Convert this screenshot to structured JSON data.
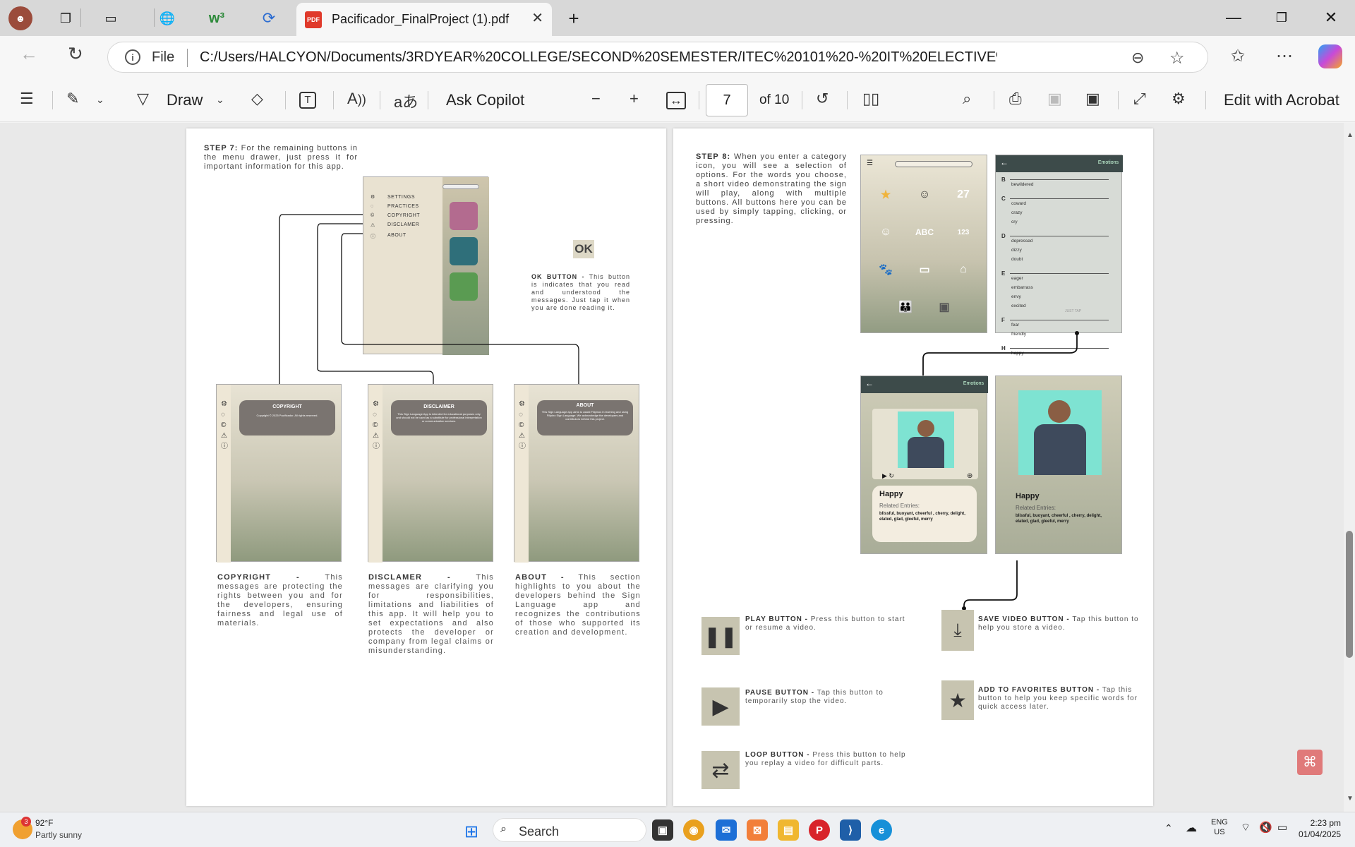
{
  "browser": {
    "tab_title": "Pacificador_FinalProject (1).pdf",
    "tab_icon": "pdf-file-icon",
    "address_prefix": "File",
    "url": "C:/Users/HALCYON/Documents/3RDYEAR%20COLLEGE/SECOND%20SEMESTER/ITEC%20101%20-%20IT%20ELECTIVE%201%20(HUMAN..."
  },
  "pdf_toolbar": {
    "draw_label": "Draw",
    "ask_copilot_label": "Ask Copilot",
    "page_current": "7",
    "page_total_label": "of 10",
    "edit_acrobat_label": "Edit with Acrobat",
    "pdf_badge": "PDF"
  },
  "left_page": {
    "step7_label": "STEP 7:",
    "step7_text": "For the remaining buttons in the menu drawer, just press it for important information for this app.",
    "menu_items": [
      "SETTINGS",
      "PRACTICES",
      "COPYRIGHT",
      "DISCLAMER",
      "ABOUT"
    ],
    "ok_label": "OK",
    "ok_caption_label": "OK BUTTON -",
    "ok_caption": "This button is indicates that you read and understood the messages. Just tap it when you are done reading it.",
    "dialog_copyright_title": "COPYRIGHT",
    "dialog_copyright_body": "Copyright © 2025 Pacificador. All rights reserved.",
    "dialog_disclaimer_title": "DISCLAIMER",
    "dialog_disclaimer_body": "This Sign Language App is intended for educational purposes only and should not be used as a substitute for professional interpretation or communication services.",
    "dialog_about_title": "ABOUT",
    "dialog_about_body": "This Sign Language app aims to assist Filipinos in learning and using Filipino Sign Language. We acknowledge the developers and contributors behind this project.",
    "copyright_label": "COPYRIGHT -",
    "copyright_text": "This messages are protecting the rights between you and for the developers, ensuring fairness and legal use of materials.",
    "disclamer_label": "DISCLAMER -",
    "disclamer_text": "This messages are clarifying you for responsibilities, limitations and liabilities of this app. It will help you to set expectations and also protects the developer or company from legal claims or misunderstanding.",
    "about_label": "ABOUT -",
    "about_text": "This section highlights to you about the developers behind the Sign Language app and recognizes the contributions of those who supported its creation and development."
  },
  "right_page": {
    "step8_label": "STEP 8:",
    "step8_text": "When you enter a category icon, you will see a selection of options. For the words you choose, a short video demonstrating the sign will play, along with multiple buttons. All buttons here you can be used by simply tapping, clicking, or pressing.",
    "category_icons": [
      {
        "label": "ESSENTIALS",
        "color": "#5b3a55"
      },
      {
        "label": "GREETINGS",
        "color": "#e9e2cf"
      },
      {
        "label": "DAYS",
        "color": "#b36b8f"
      },
      {
        "label": "EMOTIONS",
        "color": "#2f2f33"
      },
      {
        "label": "ALPHABET",
        "color": "#d98f8f"
      },
      {
        "label": "NUMBERS",
        "color": "#2f6f7a"
      },
      {
        "label": "ANIMALS",
        "color": "#3d7d8a"
      },
      {
        "label": "FINANCE",
        "color": "#e0a24e"
      },
      {
        "label": "HOME",
        "color": "#5a9b52"
      },
      {
        "label": "FAMILY",
        "color": "#8e3d86"
      },
      {
        "label": "SCHOOL",
        "color": "#e6e1d2"
      }
    ],
    "list_header": "Emotions",
    "word_list": [
      {
        "letter": "B",
        "words": [
          "bewildered"
        ]
      },
      {
        "letter": "C",
        "words": [
          "coward",
          "crazy",
          "cry"
        ]
      },
      {
        "letter": "D",
        "words": [
          "depressed",
          "dizzy",
          "doubt"
        ]
      },
      {
        "letter": "E",
        "words": [
          "eager",
          "embarrass",
          "envy",
          "excited"
        ]
      },
      {
        "letter": "F",
        "words": [
          "fear",
          "friendly"
        ]
      },
      {
        "letter": "H",
        "words": [
          "happy"
        ]
      }
    ],
    "just_tap": "JUST TAP",
    "video_word": "Happy",
    "related_label": "Related Entries:",
    "related_words": "blissful, buoyant, cheerful , cherry, delight, elated, glad, gleeful, merry",
    "play_label": "PLAY BUTTON -",
    "play_text": "Press this button to start or resume a video.",
    "pause_label": "PAUSE BUTTON -",
    "pause_text": "Tap this button to temporarily stop the video.",
    "loop_label": "LOOP BUTTON -",
    "loop_text": "Press this button to help you replay a video for difficult parts.",
    "save_label": "SAVE VIDEO BUTTON -",
    "save_text": "Tap this button to help you store a video.",
    "fav_label": "ADD TO FAVORITES BUTTON -",
    "fav_text": "Tap this button to help you keep specific words for quick access later."
  },
  "taskbar": {
    "weather_temp": "92°F",
    "weather_desc": "Partly sunny",
    "weather_badge": "3",
    "search_label": "Search",
    "lang_line1": "ENG",
    "lang_line2": "US",
    "time": "2:23 pm",
    "date": "01/04/2025"
  }
}
